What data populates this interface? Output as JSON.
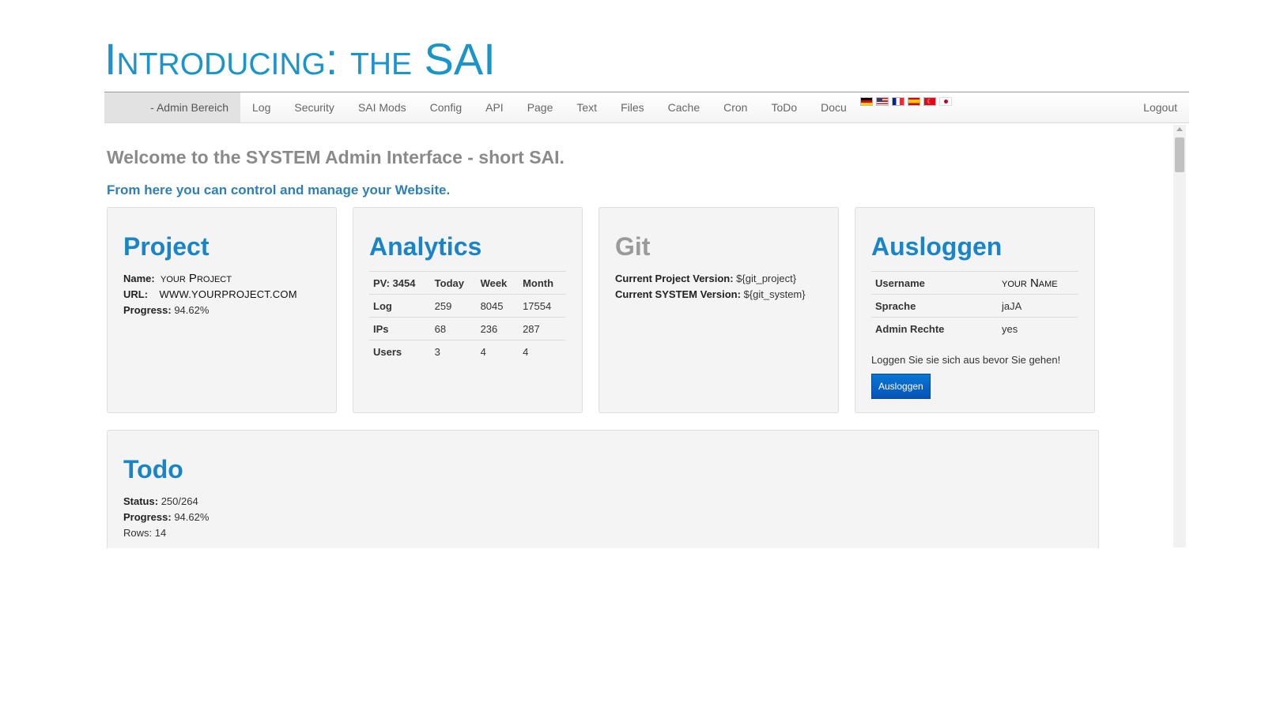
{
  "header": {
    "title": "Introducing: the SAI"
  },
  "nav": {
    "brand": "- Admin Bereich",
    "items": [
      "Log",
      "Security",
      "SAI Mods",
      "Config",
      "API",
      "Page",
      "Text",
      "Files",
      "Cache",
      "Cron",
      "ToDo",
      "Docu"
    ],
    "flags": [
      "flag-de-icon",
      "flag-us-icon",
      "flag-fr-icon",
      "flag-es-icon",
      "flag-tr-icon",
      "flag-jp-icon"
    ],
    "logout": "Logout"
  },
  "main": {
    "welcome": "Welcome to the SYSTEM Admin Interface - short SAI.",
    "subtitle": "From here you can control and manage your Website."
  },
  "project": {
    "title": "Project",
    "name_label": "Name:",
    "name_value": "your Project",
    "url_label": "URL:",
    "url_value": "WWW.YOURPROJECT.COM",
    "progress_label": "Progress:",
    "progress_value": "94.62%"
  },
  "analytics": {
    "title": "Analytics",
    "headers": [
      "PV: 3454",
      "Today",
      "Week",
      "Month"
    ],
    "rows": [
      [
        "Log",
        "259",
        "8045",
        "17554"
      ],
      [
        "IPs",
        "68",
        "236",
        "287"
      ],
      [
        "Users",
        "3",
        "4",
        "4"
      ]
    ]
  },
  "git": {
    "title": "Git",
    "project_label": "Current Project Version:",
    "project_value": "${git_project}",
    "system_label": "Current SYSTEM Version:",
    "system_value": "${git_system}"
  },
  "logout_card": {
    "title": "Ausloggen",
    "rows": [
      [
        "Username",
        "your Name"
      ],
      [
        "Sprache",
        "jaJA"
      ],
      [
        "Admin Rechte",
        "yes"
      ]
    ],
    "note": "Loggen Sie sie sich aus bevor Sie gehen!",
    "button": "Ausloggen"
  },
  "todo": {
    "title": "Todo",
    "status_label": "Status:",
    "status_value": "250/264",
    "progress_label": "Progress:",
    "progress_value": "94.62%",
    "rows_text": "Rows: 14"
  }
}
